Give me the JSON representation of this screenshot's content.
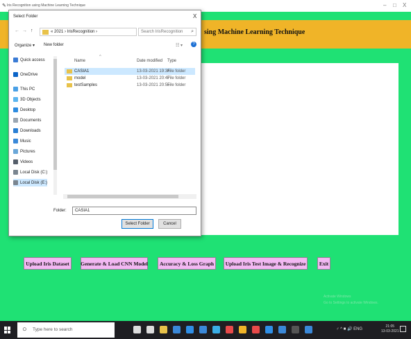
{
  "app": {
    "window_title": "Iris Recognition using Machine Learning Technique",
    "banner_title": "sing Machine Learning Technique",
    "buttons": [
      "Upload Iris Dataset",
      "Generate & Load CNN Model",
      "Accuracy & Loss Graph",
      "Upload Iris Test Image & Recognize",
      "Exit"
    ],
    "watermark": [
      "Activate Windows",
      "Go to Settings to activate Windows."
    ],
    "colors": {
      "background": "#1fe174",
      "banner": "#f0b428",
      "button": "#f3b8f3"
    }
  },
  "dialog": {
    "title": "Select Folder",
    "close_glyph": "X",
    "nav": {
      "back": "←",
      "forward": "→",
      "up": "↑"
    },
    "address": "« 2021 › IrisRecognition ›",
    "search_placeholder": "Search IrisRecognition",
    "organize_label": "Organize ▾",
    "new_folder_label": "New folder",
    "nav_items": [
      {
        "label": "Quick access",
        "icon": "star-icon",
        "color": "#3a7bd5"
      },
      {
        "label": "OneDrive",
        "icon": "cloud-icon",
        "color": "#0a64c8"
      },
      {
        "label": "This PC",
        "icon": "computer-icon",
        "color": "#4aa0e6"
      },
      {
        "label": "3D Objects",
        "icon": "cube-icon",
        "color": "#5bb5f0"
      },
      {
        "label": "Desktop",
        "icon": "desktop-icon",
        "color": "#2c8be0"
      },
      {
        "label": "Documents",
        "icon": "document-icon",
        "color": "#9aa6b2"
      },
      {
        "label": "Downloads",
        "icon": "download-icon",
        "color": "#2a7fd4"
      },
      {
        "label": "Music",
        "icon": "music-icon",
        "color": "#3a88d8"
      },
      {
        "label": "Pictures",
        "icon": "picture-icon",
        "color": "#6aa7d8"
      },
      {
        "label": "Videos",
        "icon": "video-icon",
        "color": "#555e6a"
      },
      {
        "label": "Local Disk (C:)",
        "icon": "drive-icon",
        "color": "#7a8590"
      },
      {
        "label": "Local Disk (E:)",
        "icon": "drive-icon",
        "color": "#7a8590"
      }
    ],
    "columns": [
      "Name",
      "Date modified",
      "Type"
    ],
    "files": [
      {
        "name": "CASIA1",
        "date": "13-03-2021 19:34",
        "type": "File folder"
      },
      {
        "name": "model",
        "date": "13-03-2021 20:47",
        "type": "File folder"
      },
      {
        "name": "testSamples",
        "date": "13-03-2021 20:55",
        "type": "File folder"
      }
    ],
    "folder_label": "Folder:",
    "folder_value": "CASIA1",
    "select_button": "Select Folder",
    "cancel_button": "Cancel"
  },
  "taskbar": {
    "search_placeholder": "Type here to search",
    "time": "21:05",
    "date": "13-03-2021",
    "icons": [
      {
        "name": "cortana-icon",
        "color": "#dddddd"
      },
      {
        "name": "task-view-icon",
        "color": "#dddddd"
      },
      {
        "name": "file-explorer-icon",
        "color": "#e8c24a"
      },
      {
        "name": "store-icon",
        "color": "#3a88d8"
      },
      {
        "name": "edge-icon",
        "color": "#2f8fe6"
      },
      {
        "name": "mail-icon",
        "color": "#3a88d8"
      },
      {
        "name": "app-icon-1",
        "color": "#3aaee6"
      },
      {
        "name": "app-icon-2",
        "color": "#e84a4a"
      },
      {
        "name": "chrome-icon",
        "color": "#f0b428"
      },
      {
        "name": "app-icon-3",
        "color": "#e84a4a"
      },
      {
        "name": "app-icon-4",
        "color": "#2f8fe6"
      },
      {
        "name": "app-icon-5",
        "color": "#3a88d8"
      },
      {
        "name": "terminal-icon",
        "color": "#555555"
      },
      {
        "name": "python-icon",
        "color": "#3a88d8"
      }
    ],
    "tray": "♂ ^ ■ 🔊 ENG"
  }
}
